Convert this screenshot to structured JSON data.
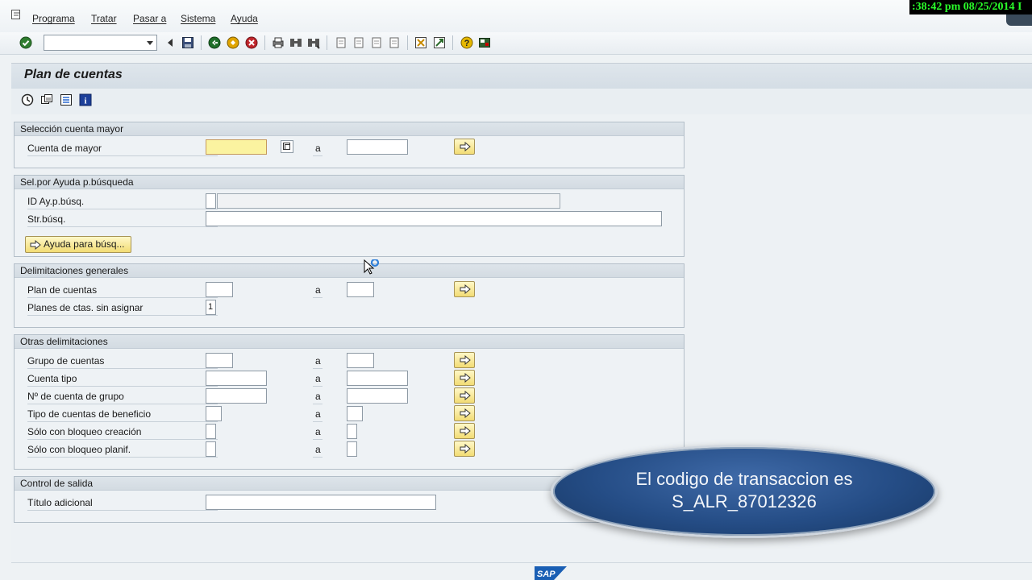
{
  "menu": [
    "Programa",
    "Tratar",
    "Pasar a",
    "Sistema",
    "Ayuda"
  ],
  "clock": ":38:42 pm 08/25/2014 I",
  "command_field": "",
  "screen_title": "Plan de cuentas",
  "groups": {
    "seleccion": {
      "title": "Selección cuenta mayor",
      "rows": [
        {
          "label": "Cuenta de mayor",
          "to": "a"
        }
      ]
    },
    "ayuda": {
      "title": "Sel.por Ayuda p.búsqueda",
      "id_label": "ID Ay.p.búsq.",
      "str_label": "Str.búsq.",
      "button": "Ayuda para búsq..."
    },
    "delim": {
      "title": "Delimitaciones generales",
      "plan_label": "Plan de cuentas",
      "to": "a",
      "sin_label": "Planes de ctas. sin asignar",
      "sin_value": "1"
    },
    "otras": {
      "title": "Otras delimitaciones",
      "rows": [
        {
          "label": "Grupo de cuentas",
          "to": "a"
        },
        {
          "label": "Cuenta tipo",
          "to": "a"
        },
        {
          "label": "Nº de cuenta de grupo",
          "to": "a"
        },
        {
          "label": "Tipo de cuentas de beneficio",
          "to": "a"
        },
        {
          "label": "Sólo con bloqueo creación",
          "to": "a"
        },
        {
          "label": "Sólo con bloqueo planif.",
          "to": "a"
        }
      ]
    },
    "salida": {
      "title": "Control de salida",
      "titulo_label": "Título adicional"
    }
  },
  "overlay": {
    "line1": "El codigo de transaccion es",
    "line2": "S_ALR_87012326"
  },
  "logo_text": "SAP"
}
